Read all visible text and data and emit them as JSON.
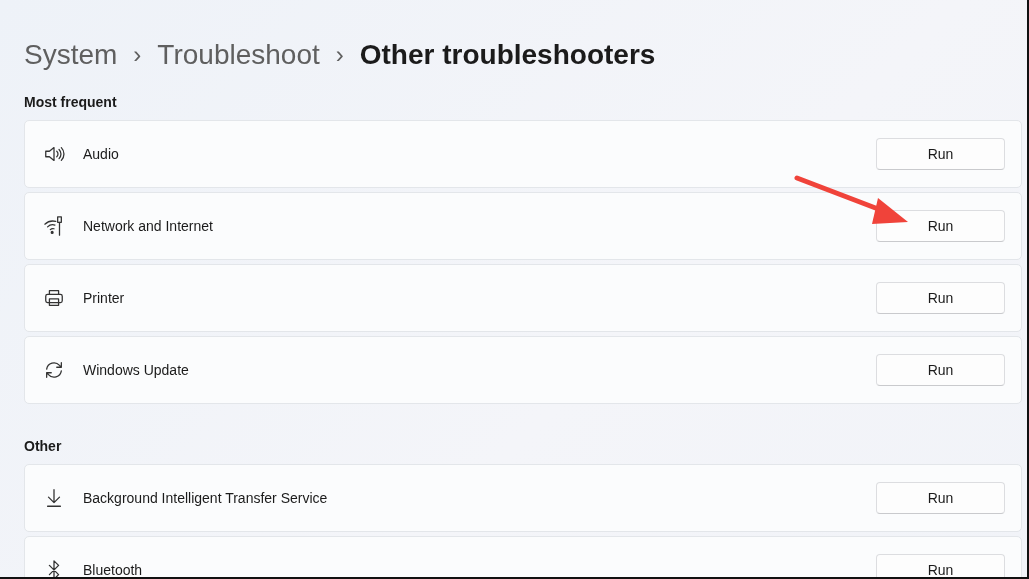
{
  "breadcrumb": [
    {
      "label": "System",
      "current": false
    },
    {
      "label": "Troubleshoot",
      "current": false
    },
    {
      "label": "Other troubleshooters",
      "current": true
    }
  ],
  "separator": "›",
  "sections": [
    {
      "title": "Most frequent",
      "items": [
        {
          "label": "Audio",
          "button": "Run"
        },
        {
          "label": "Network and Internet",
          "button": "Run"
        },
        {
          "label": "Printer",
          "button": "Run"
        },
        {
          "label": "Windows Update",
          "button": "Run"
        }
      ]
    },
    {
      "title": "Other",
      "items": [
        {
          "label": "Background Intelligent Transfer Service",
          "button": "Run"
        },
        {
          "label": "Bluetooth",
          "button": "Run"
        }
      ]
    }
  ]
}
